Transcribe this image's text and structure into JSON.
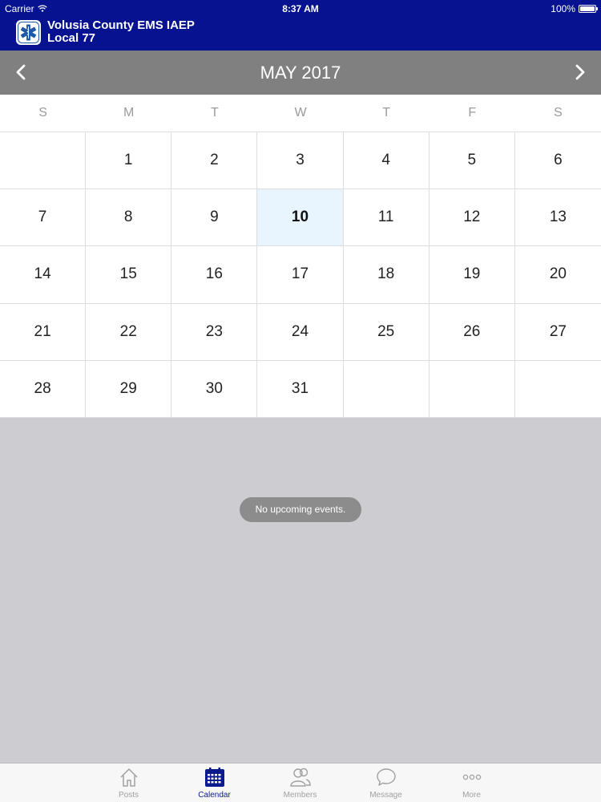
{
  "status_bar": {
    "carrier": "Carrier",
    "time": "8:37 AM",
    "battery": "100%"
  },
  "app": {
    "title_line1": "Volusia County EMS IAEP",
    "title_line2": "Local 77",
    "header_color": "#06128f"
  },
  "calendar": {
    "month_label": "MAY 2017",
    "weekdays": [
      "S",
      "M",
      "T",
      "W",
      "T",
      "F",
      "S"
    ],
    "weeks": [
      [
        "",
        "1",
        "2",
        "3",
        "4",
        "5",
        "6"
      ],
      [
        "7",
        "8",
        "9",
        "10",
        "11",
        "12",
        "13"
      ],
      [
        "14",
        "15",
        "16",
        "17",
        "18",
        "19",
        "20"
      ],
      [
        "21",
        "22",
        "23",
        "24",
        "25",
        "26",
        "27"
      ],
      [
        "28",
        "29",
        "30",
        "31",
        "",
        "",
        ""
      ]
    ],
    "selected_day": "10",
    "selected_color": "#e8f4fe"
  },
  "events": {
    "empty_message": "No upcoming events."
  },
  "tabs": [
    {
      "label": "Posts",
      "icon": "home-icon",
      "active": false
    },
    {
      "label": "Calendar",
      "icon": "calendar-icon",
      "active": true
    },
    {
      "label": "Members",
      "icon": "members-icon",
      "active": false
    },
    {
      "label": "Message",
      "icon": "message-icon",
      "active": false
    },
    {
      "label": "More",
      "icon": "more-icon",
      "active": false
    }
  ]
}
